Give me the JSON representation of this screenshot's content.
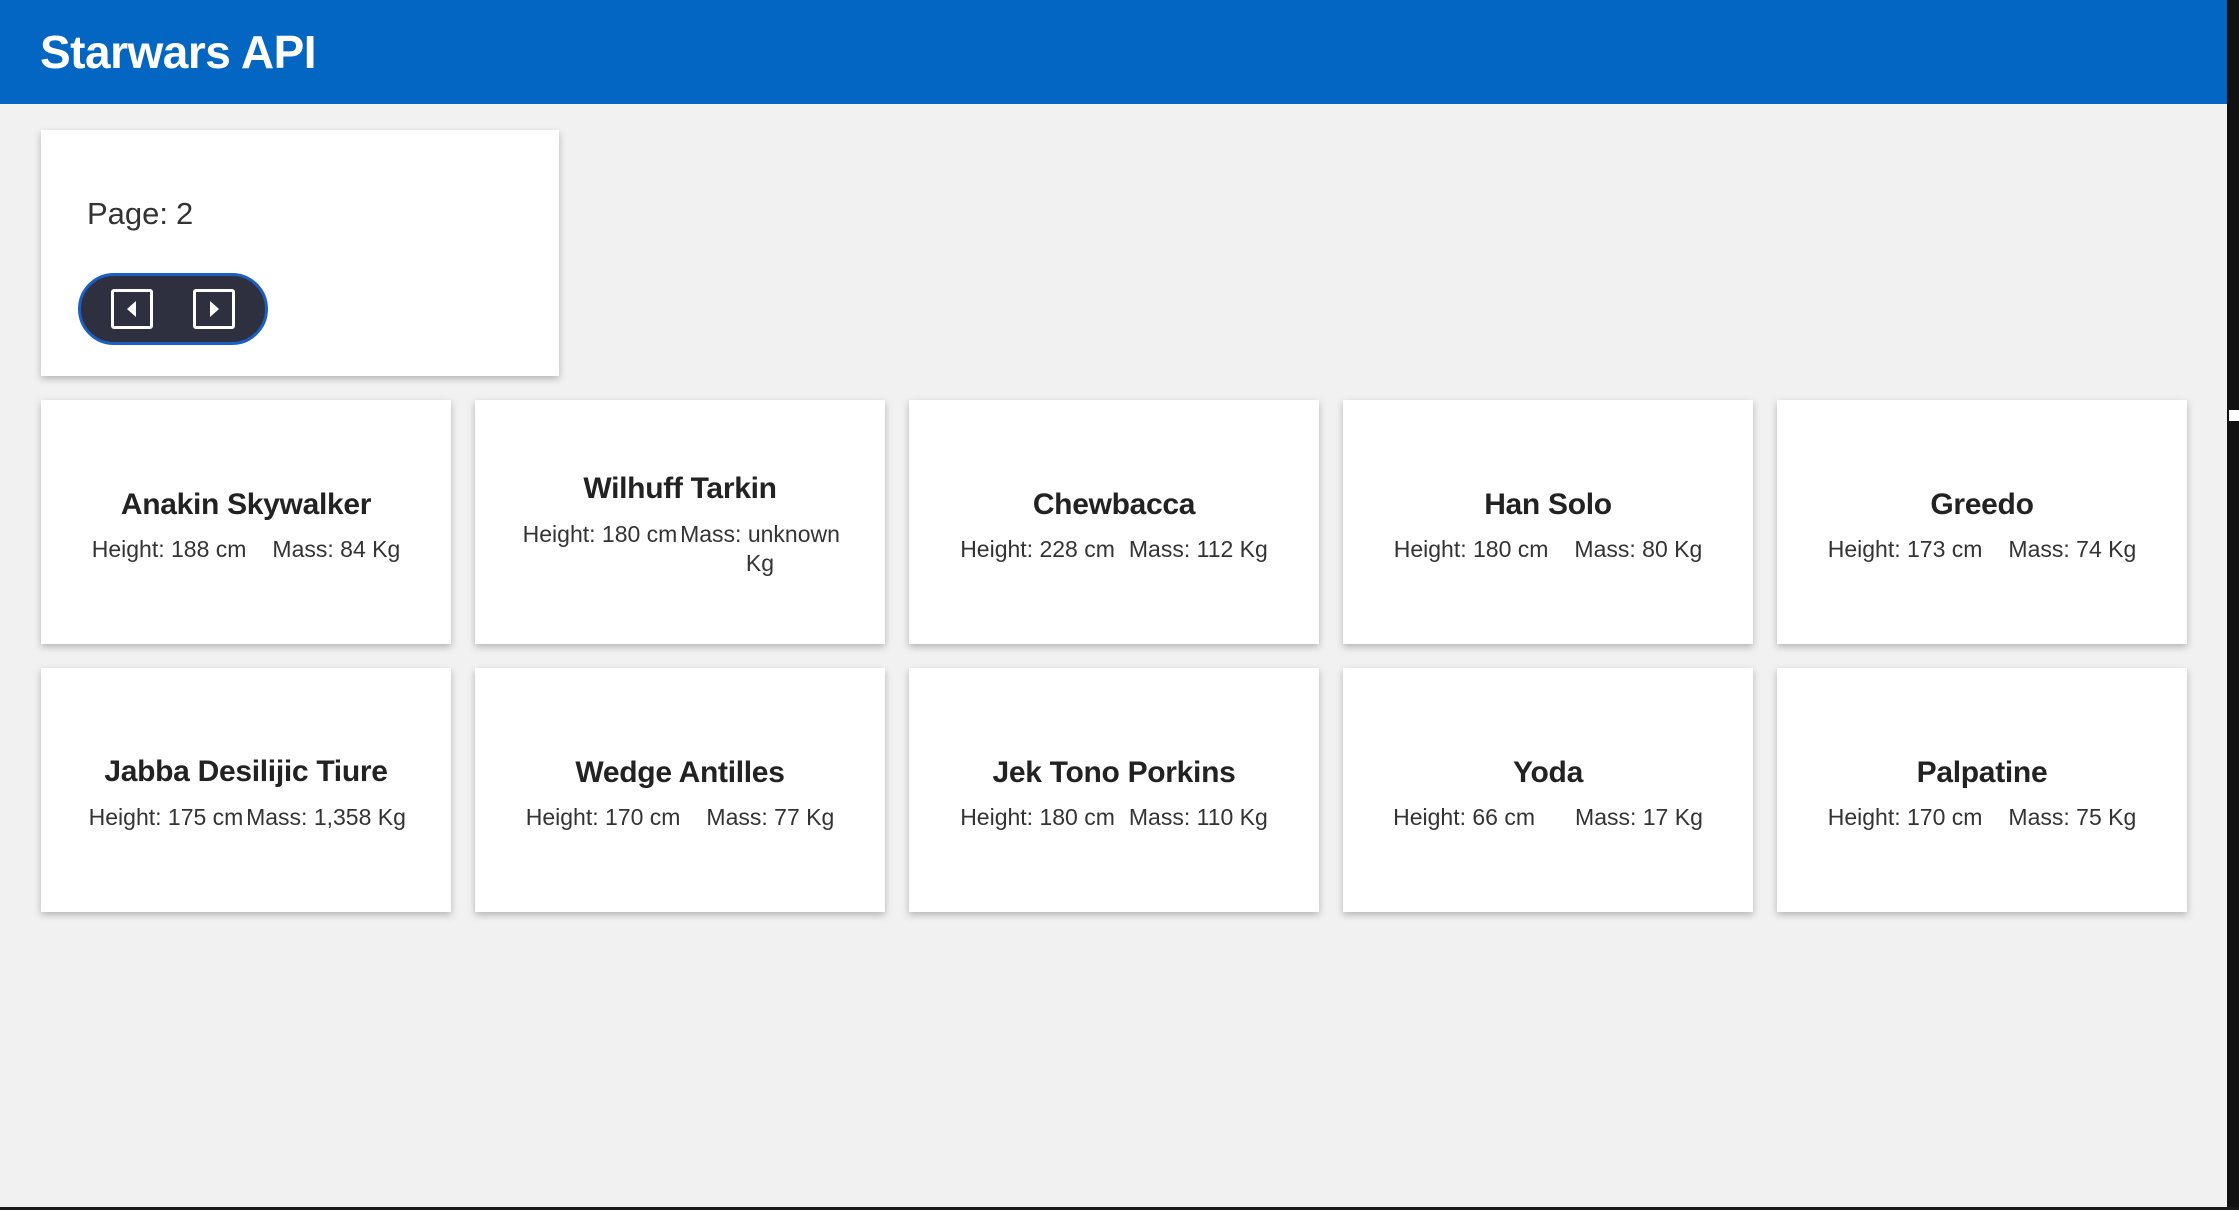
{
  "header": {
    "title": "Starwars API"
  },
  "pager": {
    "label": "Page:",
    "page": "2",
    "prev_icon": "caret-left-square-icon",
    "next_icon": "caret-right-square-icon"
  },
  "people": [
    {
      "name": "Anakin Skywalker",
      "height": "Height: 188 cm",
      "mass": "Mass: 84 Kg"
    },
    {
      "name": "Wilhuff Tarkin",
      "height": "Height: 180 cm",
      "mass": "Mass: unknown Kg"
    },
    {
      "name": "Chewbacca",
      "height": "Height: 228 cm",
      "mass": "Mass: 112 Kg"
    },
    {
      "name": "Han Solo",
      "height": "Height: 180 cm",
      "mass": "Mass: 80 Kg"
    },
    {
      "name": "Greedo",
      "height": "Height: 173 cm",
      "mass": "Mass: 74 Kg"
    },
    {
      "name": "Jabba Desilijic Tiure",
      "height": "Height: 175 cm",
      "mass": "Mass: 1,358 Kg"
    },
    {
      "name": "Wedge Antilles",
      "height": "Height: 170 cm",
      "mass": "Mass: 77 Kg"
    },
    {
      "name": "Jek Tono Porkins",
      "height": "Height: 180 cm",
      "mass": "Mass: 110 Kg"
    },
    {
      "name": "Yoda",
      "height": "Height: 66 cm",
      "mass": "Mass: 17 Kg"
    },
    {
      "name": "Palpatine",
      "height": "Height: 170 cm",
      "mass": "Mass: 75 Kg"
    }
  ],
  "colors": {
    "header_bg": "#0366c3",
    "page_bg": "#f1f1f1",
    "pager_bg": "#2e3040",
    "pager_border": "#1a5fc1"
  }
}
